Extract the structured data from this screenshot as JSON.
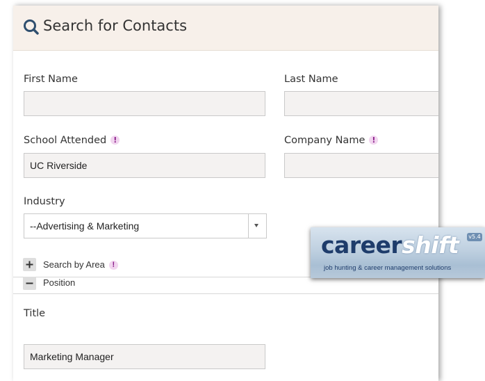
{
  "header": {
    "title": "Search for Contacts",
    "icon": "search-icon"
  },
  "form": {
    "first_name": {
      "label": "First Name",
      "value": ""
    },
    "last_name": {
      "label": "Last Name",
      "value": ""
    },
    "school": {
      "label": "School Attended",
      "value": "UC Riverside",
      "info_mark": "!"
    },
    "company": {
      "label": "Company Name",
      "value": "",
      "info_mark": "!"
    },
    "industry": {
      "label": "Industry",
      "selected": "--Advertising & Marketing"
    },
    "search_by_area": {
      "label": "Search by Area",
      "toggle": "+",
      "expanded": false,
      "info_mark": "!"
    },
    "position": {
      "label": "Position",
      "toggle": "−",
      "expanded": true
    },
    "title_field": {
      "label": "Title",
      "value": "Marketing Manager"
    }
  },
  "logo": {
    "brand_part1": "career",
    "brand_part2": "shift",
    "version": "v5.4",
    "tagline": "job hunting & career management solutions"
  },
  "colors": {
    "header_bg": "#f7f0ea",
    "info_mark_bg": "#f1d5ef",
    "info_mark_fg": "#8a1d8a",
    "logo_navy": "#1e3c6b"
  }
}
